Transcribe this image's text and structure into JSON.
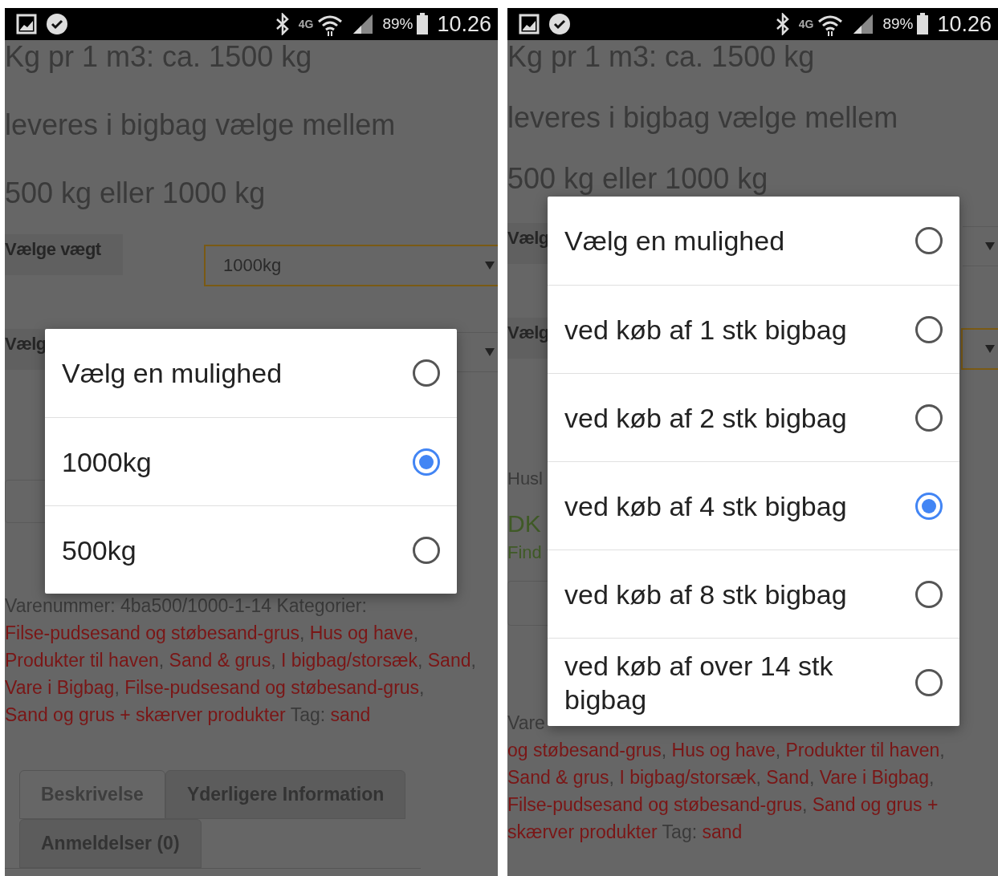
{
  "screens": [
    {
      "status_bar": {
        "network": "4G",
        "battery": "89%",
        "time": "10.26"
      },
      "page": {
        "intro_lines": [
          "Kg pr 1 m3: ca. 1500 kg",
          "leveres i bigbag vælge mellem",
          "500 kg eller 1000 kg"
        ],
        "weight_label": "Vælge vægt",
        "weight_value": "1000kg",
        "second_label": "Vælg",
        "meta": [
          {
            "kind": "plain",
            "text": "Varenummer: 4ba500/1000-1-14 Kategorier: "
          },
          {
            "kind": "link",
            "text": "Filse-pudsesand og støbesand-grus"
          },
          {
            "kind": "plain",
            "text": ", "
          },
          {
            "kind": "link",
            "text": "Hus og have"
          },
          {
            "kind": "plain",
            "text": ", "
          },
          {
            "kind": "link",
            "text": "Produkter til haven"
          },
          {
            "kind": "plain",
            "text": ", "
          },
          {
            "kind": "link",
            "text": "Sand & grus"
          },
          {
            "kind": "plain",
            "text": ", "
          },
          {
            "kind": "link",
            "text": "I bigbag/storsæk"
          },
          {
            "kind": "plain",
            "text": ", "
          },
          {
            "kind": "link",
            "text": "Sand"
          },
          {
            "kind": "plain",
            "text": ", "
          },
          {
            "kind": "link",
            "text": "Vare i Bigbag"
          },
          {
            "kind": "plain",
            "text": ", "
          },
          {
            "kind": "link",
            "text": "Filse-pudsesand og støbesand-grus"
          },
          {
            "kind": "plain",
            "text": ", "
          },
          {
            "kind": "link",
            "text": "Sand og grus + skærver produkter"
          },
          {
            "kind": "plain",
            "text": " Tag: "
          },
          {
            "kind": "link",
            "text": "sand"
          }
        ],
        "tabs": [
          {
            "label": "Beskrivelse",
            "selected": true
          },
          {
            "label": "Yderligere Information",
            "selected": false
          },
          {
            "label": "Anmeldelser (0)",
            "selected": false
          }
        ]
      },
      "dialog": {
        "options": [
          {
            "label": "Vælg en mulighed",
            "selected": false
          },
          {
            "label": "1000kg",
            "selected": true
          },
          {
            "label": "500kg",
            "selected": false
          }
        ]
      }
    },
    {
      "status_bar": {
        "network": "4G",
        "battery": "89%",
        "time": "10.26"
      },
      "page": {
        "intro_lines": [
          "Kg pr 1 m3: ca. 1500 kg",
          "leveres i bigbag vælge mellem",
          "500 kg eller 1000 kg"
        ],
        "first_label": "Vælg",
        "second_label": "Vælg",
        "note": "Husl",
        "price": "DK",
        "price_note": "Find",
        "meta_start": "Vare",
        "meta": [
          {
            "kind": "link",
            "text": "og støbesand-grus"
          },
          {
            "kind": "plain",
            "text": ", "
          },
          {
            "kind": "link",
            "text": "Hus og have"
          },
          {
            "kind": "plain",
            "text": ", "
          },
          {
            "kind": "link",
            "text": "Produkter til haven"
          },
          {
            "kind": "plain",
            "text": ", "
          },
          {
            "kind": "link",
            "text": "Sand & grus"
          },
          {
            "kind": "plain",
            "text": ", "
          },
          {
            "kind": "link",
            "text": "I bigbag/storsæk"
          },
          {
            "kind": "plain",
            "text": ", "
          },
          {
            "kind": "link",
            "text": "Sand"
          },
          {
            "kind": "plain",
            "text": ", "
          },
          {
            "kind": "link",
            "text": "Vare i Bigbag"
          },
          {
            "kind": "plain",
            "text": ", "
          },
          {
            "kind": "link",
            "text": "Filse-pudsesand og støbesand-grus"
          },
          {
            "kind": "plain",
            "text": ", "
          },
          {
            "kind": "link",
            "text": "Sand og grus +"
          },
          {
            "kind": "break"
          },
          {
            "kind": "link",
            "text": "skærver produkter"
          },
          {
            "kind": "plain",
            "text": " Tag: "
          },
          {
            "kind": "link",
            "text": "sand"
          }
        ]
      },
      "dialog": {
        "options": [
          {
            "label": "Vælg en mulighed",
            "selected": false
          },
          {
            "label": "ved køb af 1 stk bigbag",
            "selected": false
          },
          {
            "label": "ved køb af 2 stk bigbag",
            "selected": false
          },
          {
            "label": "ved køb af 4 stk bigbag",
            "selected": true
          },
          {
            "label": "ved køb af 8 stk bigbag",
            "selected": false
          },
          {
            "label": "ved køb af over 14 stk bigbag",
            "selected": false
          }
        ]
      }
    }
  ]
}
